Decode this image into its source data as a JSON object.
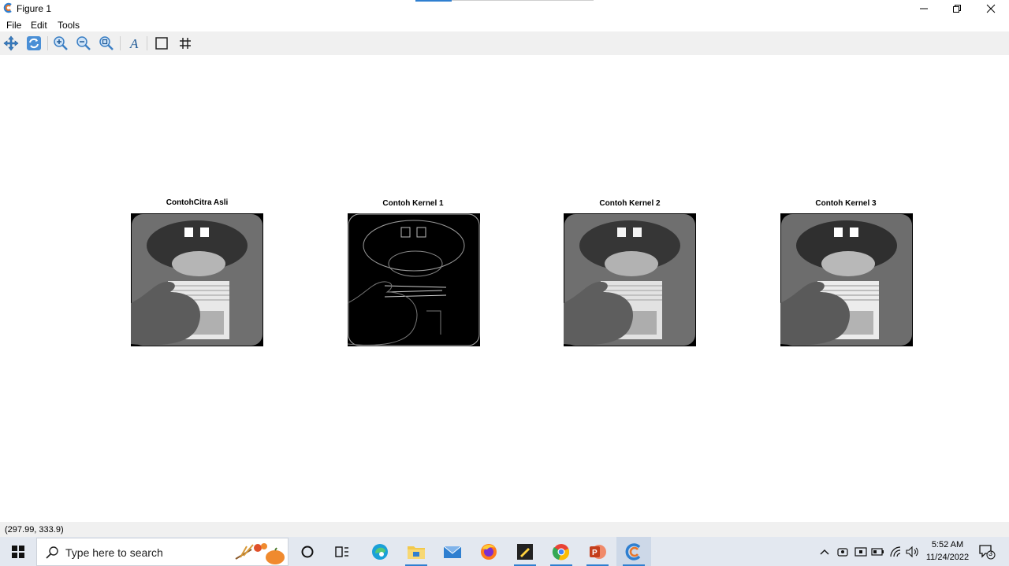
{
  "window": {
    "title": "Figure 1"
  },
  "menu": {
    "file": "File",
    "edit": "Edit",
    "tools": "Tools"
  },
  "toolbar": {
    "buttons": [
      "pan-icon",
      "reset-icon",
      "zoom-in-icon",
      "zoom-out-icon",
      "zoom-fit-icon",
      "text-icon",
      "rectangle-icon",
      "grid-icon"
    ]
  },
  "figure": {
    "panels": [
      {
        "title": "ContohCitra Asli",
        "variant": "original"
      },
      {
        "title": "Contoh Kernel 1",
        "variant": "edges"
      },
      {
        "title": "Contoh Kernel 2",
        "variant": "smooth"
      },
      {
        "title": "Contoh Kernel 3",
        "variant": "sharp"
      }
    ]
  },
  "status": {
    "coords": "(297.99, 333.9)"
  },
  "taskbar": {
    "search_placeholder": "Type here to search",
    "time": "5:52 AM",
    "date": "11/24/2022",
    "notification_count": "3"
  },
  "colors": {
    "accent": "#2f7fd0",
    "toolbar_bg": "#f0f0f0",
    "taskbar_bg": "#e3e8f0"
  }
}
